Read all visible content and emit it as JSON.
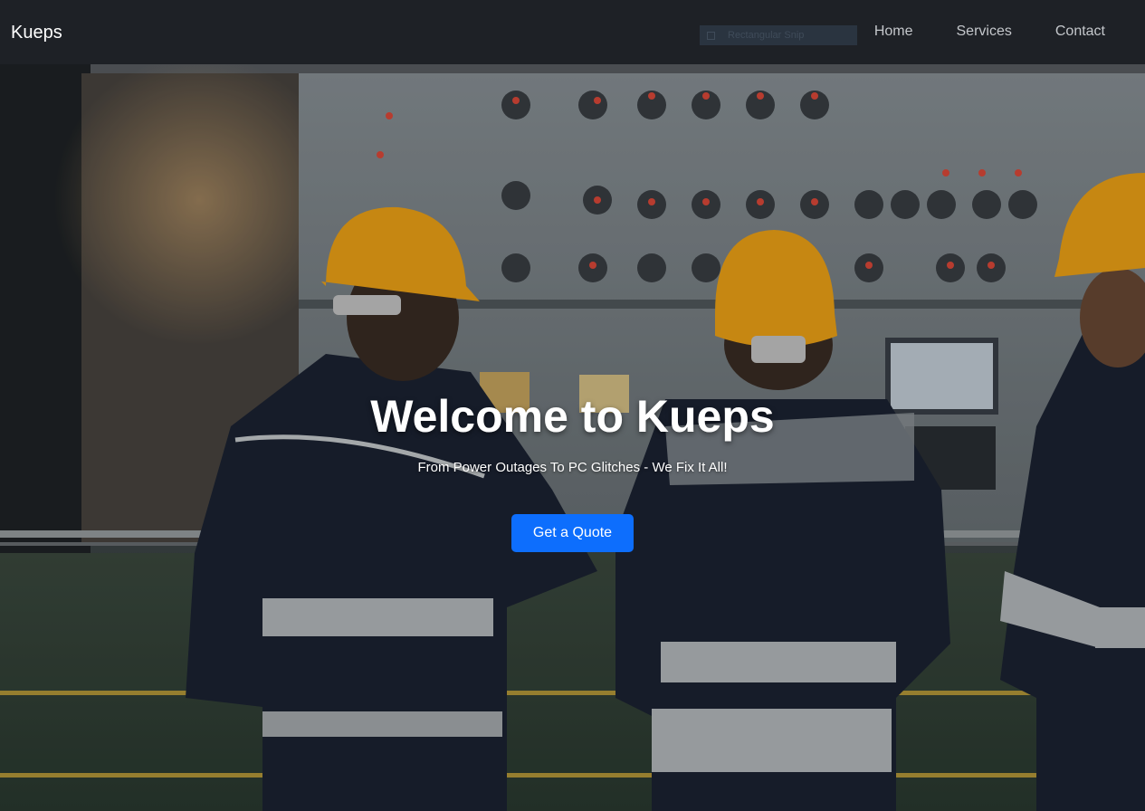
{
  "navbar": {
    "brand": "Kueps",
    "snip_label": "Rectangular Snip",
    "links": [
      {
        "label": "Home"
      },
      {
        "label": "Services"
      },
      {
        "label": "Contact"
      }
    ]
  },
  "hero": {
    "title": "Welcome to Kueps",
    "subtitle": "From Power Outages To PC Glitches - We Fix It All!",
    "cta_label": "Get a Quote",
    "background_image": "three-workers-hard-hats-control-panel",
    "cta_color": "#0d6efd"
  },
  "colors": {
    "navbar_bg": "#1e2126",
    "hardhat": "#f2a516",
    "jacket": "#1c2333"
  }
}
